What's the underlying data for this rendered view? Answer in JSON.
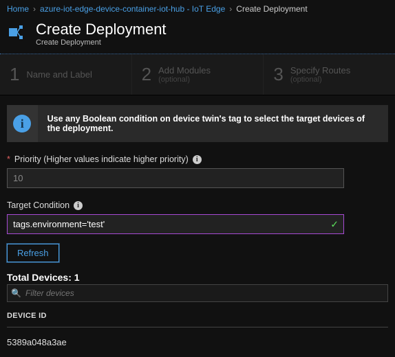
{
  "breadcrumb": {
    "home": "Home",
    "hub": "azure-iot-edge-device-container-iot-hub - IoT Edge",
    "current": "Create Deployment"
  },
  "header": {
    "title": "Create Deployment",
    "subtitle": "Create Deployment"
  },
  "steps": [
    {
      "num": "1",
      "label1": "Name and Label",
      "label2": ""
    },
    {
      "num": "2",
      "label1": "Add Modules",
      "label2": "(optional)"
    },
    {
      "num": "3",
      "label1": "Specify Routes",
      "label2": "(optional)"
    }
  ],
  "info": "Use any Boolean condition on device twin's tag to select the target devices of the deployment.",
  "priority": {
    "label": "Priority (Higher values indicate higher priority)",
    "value": "10"
  },
  "target": {
    "label": "Target Condition",
    "value": "tags.environment='test'"
  },
  "refresh_label": "Refresh",
  "total_label": "Total Devices: 1",
  "filter_placeholder": "Filter devices",
  "table": {
    "header": "DEVICE ID",
    "rows": [
      "5389a048a3ae"
    ]
  }
}
